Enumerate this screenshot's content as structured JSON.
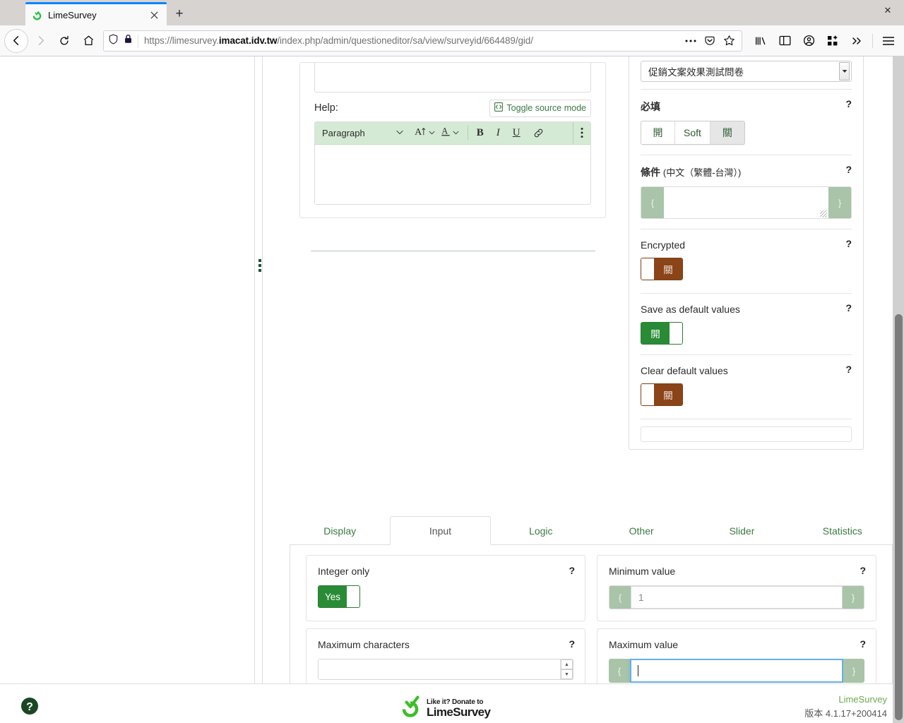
{
  "browser": {
    "tab": {
      "title": "LimeSurvey",
      "favicon_icon": "limesurvey-favicon",
      "close_icon": "close-icon"
    },
    "newtab_label": "+",
    "window_close_label": "✕",
    "nav": {
      "back_icon": "back-arrow-icon",
      "forward_icon": "forward-arrow-icon",
      "reload_icon": "reload-icon",
      "home_icon": "home-icon"
    },
    "url": {
      "shield_icon": "tracking-protection-shield-icon",
      "lock_icon": "padlock-icon",
      "prefix": "https://limesurvey.",
      "domain": "imacat.idv.tw",
      "path": "/index.php/admin/questioneditor/sa/view/surveyid/664489/gid/",
      "full": "https://limesurvey.imacat.idv.tw/index.php/admin/questioneditor/sa/view/surveyid/664489/gid/",
      "page_actions_icon": "ellipsis-icon",
      "pocket_icon": "pocket-save-icon",
      "bookmark_icon": "star-bookmark-icon"
    },
    "toolbar": {
      "library_icon": "library-icon",
      "sidebar_icon": "sidebar-icon",
      "account_icon": "account-avatar-icon",
      "extensions_icon": "extensions-grid-icon",
      "overflow_icon": "double-chevron-right-icon",
      "menu_icon": "hamburger-menu-icon"
    }
  },
  "editor": {
    "help_label": "Help:",
    "toggle_source_label": "Toggle source mode",
    "toggle_source_icon": "source-code-icon",
    "paragraph_label": "Paragraph",
    "font_size_icon": "font-size-icon",
    "font_color_icon": "font-color-icon",
    "bold_label": "B",
    "italic_label": "I",
    "underline_label": "U",
    "link_icon": "link-icon",
    "kebab_icon": "vertical-dots-icon",
    "dropdown_chevron_icon": "chevron-down-icon"
  },
  "sidebar_handle_icon": "collapse-handle-dots-icon",
  "settings": {
    "survey_select": {
      "value": "促銷文案效果測試問卷",
      "arrow_icon": "select-arrow-icon"
    },
    "help_icon_label": "?",
    "mandatory": {
      "title": "必填",
      "options": [
        "開",
        "Soft",
        "關"
      ],
      "selected": "關"
    },
    "condition": {
      "title_main": "條件",
      "title_sub": "(中文（繁體-台灣）)",
      "brace_left": "{",
      "brace_right": "}",
      "value": "",
      "resize_grip_icon": "resize-grip-icon"
    },
    "encrypted": {
      "title": "Encrypted",
      "state": "off",
      "state_label": "關"
    },
    "save_default": {
      "title": "Save as default values",
      "state": "on",
      "state_label": "開"
    },
    "clear_default": {
      "title": "Clear default values",
      "state": "off",
      "state_label": "關"
    }
  },
  "tabs": {
    "items": [
      {
        "label": "Display",
        "active": false
      },
      {
        "label": "Input",
        "active": true
      },
      {
        "label": "Logic",
        "active": false
      },
      {
        "label": "Other",
        "active": false
      },
      {
        "label": "Slider",
        "active": false
      },
      {
        "label": "Statistics",
        "active": false
      }
    ]
  },
  "input_tab": {
    "integer_only": {
      "label": "Integer only",
      "state": "on",
      "state_label": "Yes",
      "help": "?"
    },
    "minimum_value": {
      "label": "Minimum value",
      "help": "?",
      "brace_left": "{",
      "brace_right": "}",
      "value": "",
      "placeholder": "1",
      "focused": false
    },
    "maximum_characters": {
      "label": "Maximum characters",
      "help": "?",
      "value": "",
      "placeholder": "",
      "spinner_up_icon": "spinner-up-icon",
      "spinner_down_icon": "spinner-down-icon"
    },
    "maximum_value": {
      "label": "Maximum value",
      "help": "?",
      "brace_left": "{",
      "brace_right": "}",
      "value": "",
      "placeholder": "",
      "focused": true
    }
  },
  "footer": {
    "help_icon": "help-circle-icon",
    "donate_line1": "Like it? Donate to",
    "donate_line2": "LimeSurvey",
    "donate_logo_icon": "limesurvey-donate-logo",
    "brand": "LimeSurvey",
    "version": "版本 4.1.17+200414"
  },
  "colors": {
    "accent_green": "#3b7a43",
    "toolbar_green": "#d5ead5",
    "brace_green": "#a9c4a9",
    "switch_on": "#2a8b36",
    "switch_off": "#8a4418",
    "focus_blue": "#66afe9"
  }
}
